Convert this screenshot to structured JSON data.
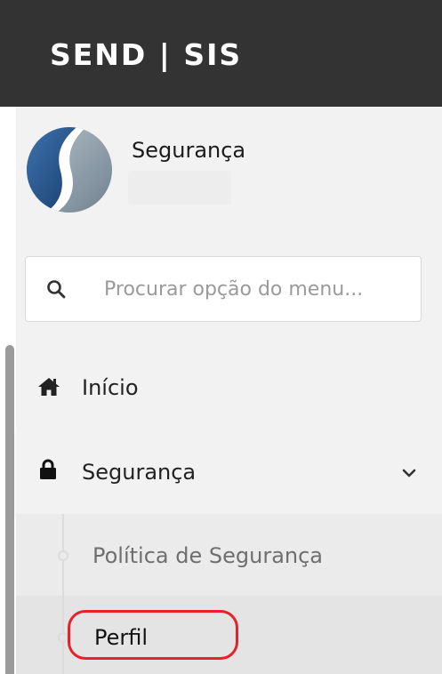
{
  "header": {
    "brand": "SEND | SIS",
    "background_color": "#333333"
  },
  "profile": {
    "name": "Segurança",
    "logo_icon": "company-logo-icon"
  },
  "search": {
    "placeholder": "Procurar opção do menu...",
    "value": "",
    "icon": "search-icon"
  },
  "menu": {
    "items": [
      {
        "label": "Início",
        "icon": "home-icon"
      },
      {
        "label": "Segurança",
        "icon": "lock-icon",
        "expanded": true,
        "toggle_icon": "chevron-down-icon"
      }
    ],
    "submenu": [
      {
        "label": "Política de Segurança"
      },
      {
        "label": "Perfil",
        "highlighted": true
      }
    ]
  },
  "colors": {
    "highlight_ring": "#e5222a",
    "sidebar_bg": "#f2f2f2",
    "submenu_bg": "#ebebeb",
    "logo_blue": "#1f4e89",
    "logo_grey": "#8a9aa6"
  }
}
